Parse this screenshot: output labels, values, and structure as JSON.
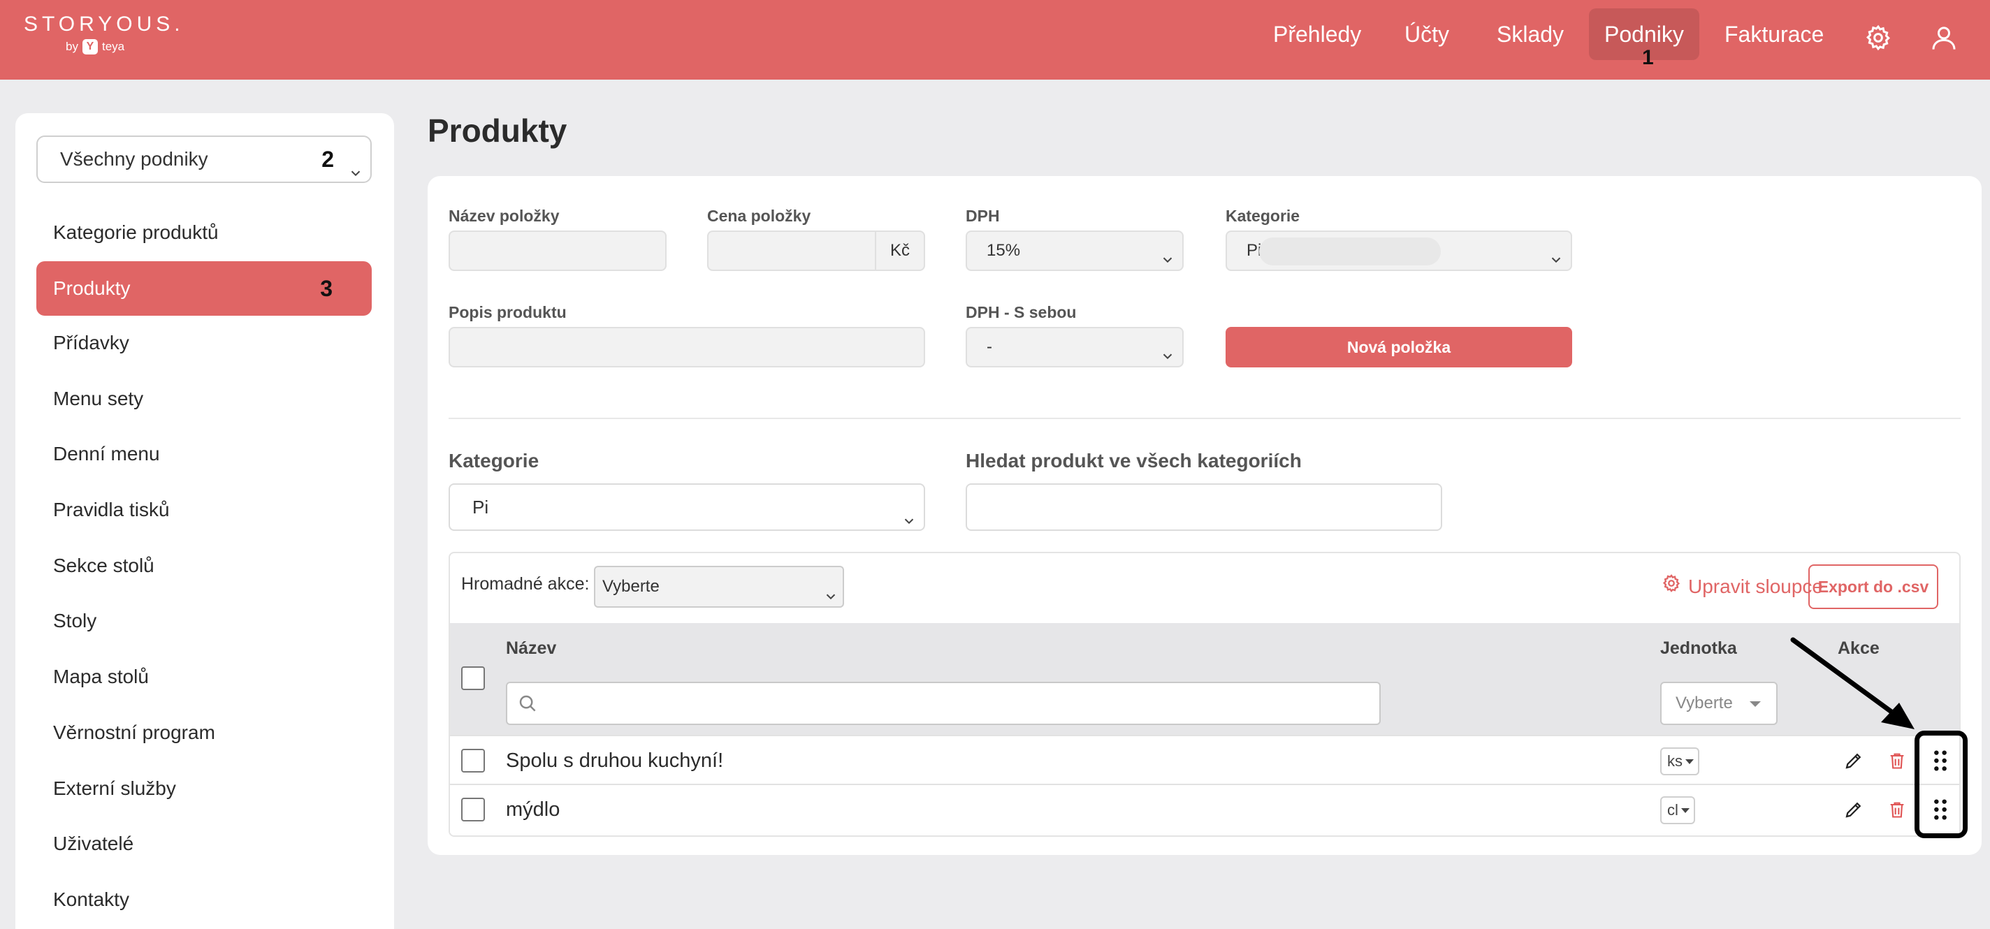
{
  "brand": {
    "name": "STORYOUS.",
    "sub_prefix": "by",
    "sub_name": "teya",
    "accent": "#e06565"
  },
  "nav": {
    "items": [
      {
        "label": "Přehledy"
      },
      {
        "label": "Účty"
      },
      {
        "label": "Sklady"
      },
      {
        "label": "Podniky",
        "active": true
      },
      {
        "label": "Fakturace"
      }
    ],
    "annotation": "1",
    "icons": [
      "gear-icon",
      "user-icon"
    ]
  },
  "sidebar": {
    "business_select": {
      "value": "Všechny podniky",
      "annotation": "2"
    },
    "items": [
      {
        "label": "Kategorie produktů"
      },
      {
        "label": "Produkty",
        "active": true,
        "annotation": "3"
      },
      {
        "label": "Přídavky"
      },
      {
        "label": "Menu sety"
      },
      {
        "label": "Denní menu"
      },
      {
        "label": "Pravidla tisků"
      },
      {
        "label": "Sekce stolů"
      },
      {
        "label": "Stoly"
      },
      {
        "label": "Mapa stolů"
      },
      {
        "label": "Věrnostní program"
      },
      {
        "label": "Externí služby"
      },
      {
        "label": "Uživatelé"
      },
      {
        "label": "Kontakty"
      }
    ]
  },
  "page": {
    "title": "Produkty"
  },
  "form": {
    "name_label": "Název položky",
    "price_label": "Cena položky",
    "price_suffix": "Kč",
    "vat_label": "DPH",
    "vat_value": "15%",
    "category_label": "Kategorie",
    "category_value": "Pi",
    "description_label": "Popis produktu",
    "vat_takeaway_label": "DPH - S sebou",
    "vat_takeaway_value": "-",
    "new_item_button": "Nová položka"
  },
  "filters": {
    "category_label": "Kategorie",
    "category_value": "Pi",
    "search_label": "Hledat produkt ve všech kategoriích"
  },
  "table": {
    "bulk_label": "Hromadné akce:",
    "bulk_value": "Vyberte",
    "edit_columns": "Upravit sloupce",
    "export": "Export do .csv",
    "columns": {
      "name": "Název",
      "unit": "Jednotka",
      "actions": "Akce"
    },
    "unit_filter_placeholder": "Vyberte",
    "rows": [
      {
        "name": "Spolu s druhou kuchyní!",
        "unit": "ks"
      },
      {
        "name": "mýdlo",
        "unit": "cl"
      }
    ]
  }
}
